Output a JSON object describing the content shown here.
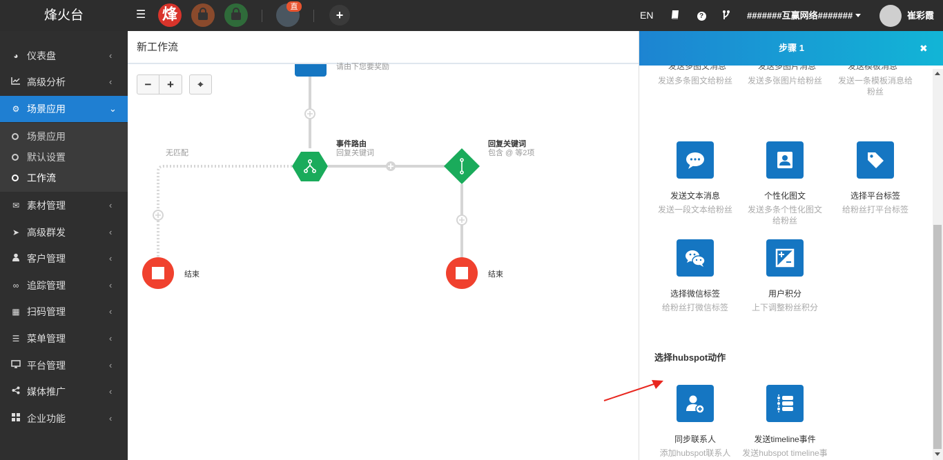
{
  "topbar": {
    "brand": "烽火台",
    "app_feng_text": "烽",
    "live_badge": "直",
    "add_symbol": "+",
    "lang": "EN",
    "account_name": "#######互赢网络#######",
    "username": "崔彩霞"
  },
  "sidebar": {
    "items": [
      {
        "label": "仪表盘",
        "icon": "dashboard-icon"
      },
      {
        "label": "高级分析",
        "icon": "chart-icon"
      },
      {
        "label": "场景应用",
        "icon": "gear-icon"
      },
      {
        "label": "素材管理",
        "icon": "envelope-icon"
      },
      {
        "label": "高级群发",
        "icon": "send-icon"
      },
      {
        "label": "客户管理",
        "icon": "user-icon"
      },
      {
        "label": "追踪管理",
        "icon": "link-icon"
      },
      {
        "label": "扫码管理",
        "icon": "qrcode-icon"
      },
      {
        "label": "菜单管理",
        "icon": "list-icon"
      },
      {
        "label": "平台管理",
        "icon": "desktop-icon"
      },
      {
        "label": "媒体推广",
        "icon": "share-icon"
      },
      {
        "label": "企业功能",
        "icon": "grid-icon"
      }
    ],
    "submenu": [
      "场景应用",
      "默认设置",
      "工作流"
    ]
  },
  "main": {
    "title": "新工作流",
    "zoom_out": "−",
    "zoom_in": "+",
    "recenter": "⌖"
  },
  "flow": {
    "top_node_sub": "请由下您要奖励",
    "router_title": "事件路由",
    "router_sub": "回复关键词",
    "keyword_title": "回复关键词",
    "keyword_sub": "包含 @ 等2项",
    "no_match": "无匹配",
    "end_left": "结束",
    "end_right": "结束"
  },
  "panel": {
    "title": "步骤 1",
    "close": "✖",
    "cut_row": [
      {
        "name": "发送多图文消息",
        "desc": "发送多条图文给粉丝"
      },
      {
        "name": "发送多图片消息",
        "desc": "发送多张图片给粉丝"
      },
      {
        "name": "发送模板消息",
        "desc": "发送一条模板消息给粉丝"
      }
    ],
    "actions": [
      {
        "name": "发送文本消息",
        "desc": "发送一段文本给粉丝",
        "icon": "chat-bubble-icon"
      },
      {
        "name": "个性化图文",
        "desc": "发送多条个性化图文给粉丝",
        "icon": "profile-card-icon"
      },
      {
        "name": "选择平台标签",
        "desc": "给粉丝打平台标签",
        "icon": "tag-icon"
      },
      {
        "name": "选择微信标签",
        "desc": "给粉丝打微信标签",
        "icon": "wechat-icon"
      },
      {
        "name": "用户积分",
        "desc": "上下调整粉丝积分",
        "icon": "plus-minus-icon"
      }
    ],
    "hubspot_title": "选择hubspot动作",
    "hubspot": [
      {
        "name": "同步联系人",
        "desc": "添加hubspot联系人",
        "icon": "add-user-icon"
      },
      {
        "name": "发送timeline事件",
        "desc": "发送hubspot timeline事件",
        "icon": "timeline-icon"
      }
    ]
  },
  "colors": {
    "accent_blue": "#1576c2",
    "node_green": "#1aab5b",
    "end_red": "#f0412e",
    "annotation_red": "#e8271f"
  }
}
